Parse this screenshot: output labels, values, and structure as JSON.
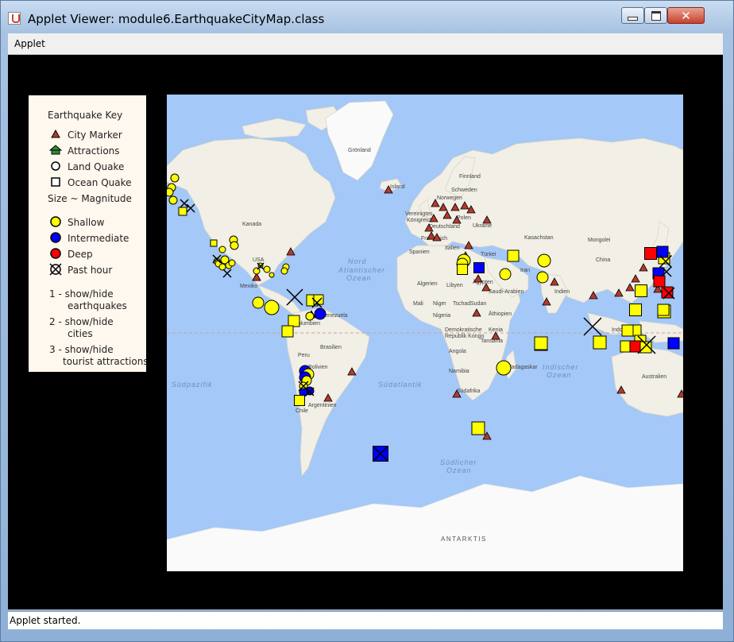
{
  "window": {
    "title": "Applet Viewer: module6.EarthquakeCityMap.class",
    "close_glyph": "✕"
  },
  "menubar": {
    "applet_label": "Applet"
  },
  "legend": {
    "title": "Earthquake Key",
    "city_marker": "City Marker",
    "attractions": "Attractions",
    "land_quake": "Land Quake",
    "ocean_quake": "Ocean Quake",
    "size": "Size ~ Magnitude",
    "shallow": "Shallow",
    "intermediate": "Intermediate",
    "deep": "Deep",
    "past_hour": "Past hour",
    "key1_a": "1 - show/hide",
    "key1_b": "earthquakes",
    "key2_a": "2 - show/hide",
    "key2_b": "cities",
    "key3_a": "3 - show/hide",
    "key3_b": "tourist attractions"
  },
  "map": {
    "labels": {
      "gronland": "Grönland",
      "island": "Island",
      "schweden": "Schweden",
      "finnland": "Finnland",
      "norwegen": "Norwegen",
      "kanada": "Kanada",
      "vereinigtes": "Vereinigtes",
      "konigreich": "Königreich",
      "polen": "Polen",
      "ukraine": "Ukraine",
      "deutschland": "Deutschland",
      "frankreich": "Frankreich",
      "spanien": "Spanien",
      "italien": "Italien",
      "turkei": "Türkei",
      "kasachstan": "Kasachstan",
      "mongolei": "Mongolei",
      "china": "China",
      "iran": "Iran",
      "indien": "Indien",
      "algerien": "Algerien",
      "libyen": "Libyen",
      "agypten": "Ägypten",
      "saudi": "Saudi-Arabien",
      "mali": "Mali",
      "niger": "Niger",
      "tschad": "Tschad",
      "sudan": "Sudan",
      "athiopien": "Äthiopien",
      "nigeria": "Nigeria",
      "kenia": "Kenia",
      "drk_a": "Demokratische",
      "drk_b": "Republik Kongo",
      "tansania": "Tansania",
      "angola": "Angola",
      "namibia": "Namibia",
      "sudafrika": "Südafrika",
      "madagaskar": "Madagaskar",
      "usa": "USA",
      "mexiko": "Mexiko",
      "kolumbien": "Kolumbien",
      "venezuela": "Venezuela",
      "peru": "Peru",
      "brasilien": "Brasilien",
      "bolivien": "Bolivien",
      "argentinien": "Argentinien",
      "chile": "Chile",
      "indonesien": "Indonesien",
      "australien": "Australien",
      "nord_a": "Nord",
      "nord_b": "Atlantischer",
      "nord_c": "Ozean",
      "sudpazifik": "Südpazifik",
      "sudatlantik": "Südatlantik",
      "indischer_a": "Indischer",
      "indischer_b": "Ozean",
      "sudlicher_a": "Südlicher",
      "sudlicher_b": "Ozean",
      "antarktis": "ANTARKTIS"
    }
  },
  "status": {
    "text": "Applet started."
  },
  "colors": {
    "ocean": "#a4c8f7",
    "land": "#f1efe6",
    "ice": "#fafafa",
    "city": "#b33a2c",
    "shallow": "#ffff00",
    "intermediate": "#0000ff",
    "deep": "#ff0000",
    "attraction": "#2e8b3a"
  },
  "icons": [
    "java-cup-icon",
    "minimize-icon",
    "maximize-icon",
    "close-icon"
  ]
}
